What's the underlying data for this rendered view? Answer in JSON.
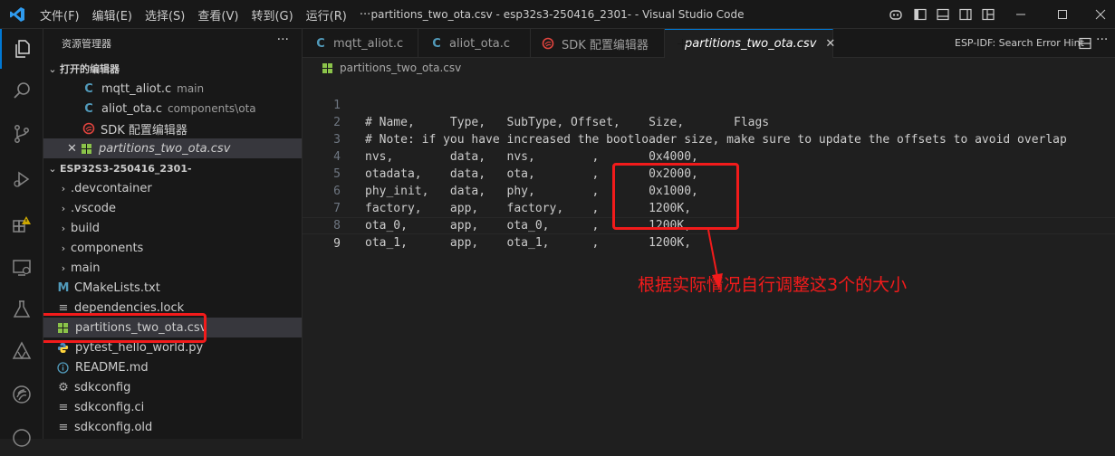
{
  "titlebar": {
    "menu": [
      "文件(F)",
      "编辑(E)",
      "选择(S)",
      "查看(V)",
      "转到(G)",
      "运行(R)",
      "···"
    ],
    "title": "partitions_two_ota.csv - esp32s3-250416_2301- - Visual Studio Code"
  },
  "sidebar": {
    "title": "资源管理器",
    "more": "···",
    "open_editors_label": "打开的编辑器",
    "open_editors": [
      {
        "name": "mqtt_aliot.c",
        "desc": "main"
      },
      {
        "name": "aliot_ota.c",
        "desc": "components\\ota"
      },
      {
        "name": "SDK 配置编辑器",
        "desc": ""
      },
      {
        "name": "partitions_two_ota.csv",
        "desc": ""
      }
    ],
    "project_label": "ESP32S3-250416_2301-",
    "files": [
      ".devcontainer",
      ".vscode",
      "build",
      "components",
      "main",
      "CMakeLists.txt",
      "dependencies.lock",
      "partitions_two_ota.csv",
      "pytest_hello_world.py",
      "README.md",
      "sdkconfig",
      "sdkconfig.ci",
      "sdkconfig.old"
    ]
  },
  "tabs": [
    {
      "label": "mqtt_aliot.c"
    },
    {
      "label": "aliot_ota.c"
    },
    {
      "label": "SDK 配置编辑器"
    },
    {
      "label": "partitions_two_ota.csv"
    }
  ],
  "tab_right_label": "ESP-IDF: Search Error Hint",
  "breadcrumb": "partitions_two_ota.csv",
  "code_lines": [
    {
      "n": "1",
      "t": "# Name,     Type,   SubType, Offset,    Size,       Flags"
    },
    {
      "n": "2",
      "t": "# Note: if you have increased the bootloader size, make sure to update the offsets to avoid overlap"
    },
    {
      "n": "3",
      "t": "nvs,        data,   nvs,        ,       0x4000,"
    },
    {
      "n": "4",
      "t": "otadata,    data,   ota,        ,       0x2000,"
    },
    {
      "n": "5",
      "t": "phy_init,   data,   phy,        ,       0x1000,"
    },
    {
      "n": "6",
      "t": "factory,    app,    factory,    ,       1200K,"
    },
    {
      "n": "7",
      "t": "ota_0,      app,    ota_0,      ,       1200K,"
    },
    {
      "n": "8",
      "t": "ota_1,      app,    ota_1,      ,       1200K,"
    },
    {
      "n": "9",
      "t": ""
    }
  ],
  "annotation": "根据实际情况自行调整这3个的大小",
  "colors": {
    "accent": "#0078d4",
    "annotation": "#f21b1b",
    "csv_icon": "#8bc34a",
    "c_icon": "#519aba"
  }
}
